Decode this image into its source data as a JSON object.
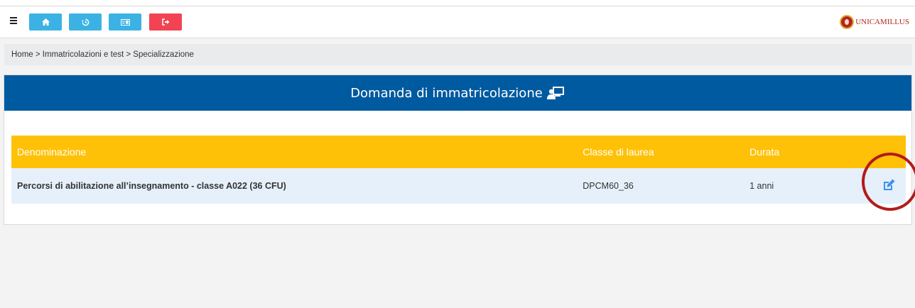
{
  "toolbar": {
    "menu_icon": "hamburger-icon",
    "buttons": [
      {
        "name": "home",
        "icon": "home-icon",
        "color": "#3bb2e3"
      },
      {
        "name": "history",
        "icon": "history-icon",
        "color": "#3bb2e3"
      },
      {
        "name": "id-card",
        "icon": "id-card-icon",
        "color": "#3bb2e3"
      },
      {
        "name": "logout",
        "icon": "logout-icon",
        "color": "#f24352"
      }
    ]
  },
  "brand": {
    "name": "UNICAMILLUS",
    "color": "#b3261e"
  },
  "breadcrumb": {
    "text": "Home > Immatricolazioni e test > Specializzazione"
  },
  "card": {
    "title": "Domanda di immatricolazione",
    "header_color": "#005aa0",
    "title_icon": "presentation-icon"
  },
  "table": {
    "header_color": "#ffc107",
    "columns": [
      "Denominazione",
      "Classe di laurea",
      "Durata"
    ],
    "rows": [
      {
        "denominazione": "Percorsi di abilitazione all’insegnamento - classe A022 (36 CFU)",
        "classe": "DPCM60_36",
        "durata": "1 anni",
        "action_icon": "edit-icon"
      }
    ]
  },
  "annotation": {
    "ring_color": "#b31b1b"
  }
}
